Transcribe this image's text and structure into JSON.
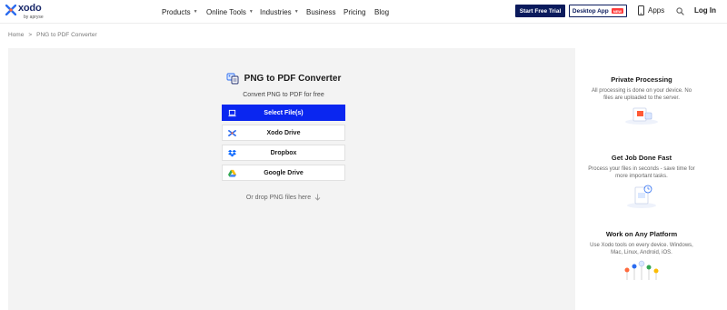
{
  "nav": {
    "logo_text": "xodo",
    "logo_sub": "by apryse",
    "menu": [
      {
        "label": "Products",
        "dropdown": true
      },
      {
        "label": "Online Tools",
        "dropdown": true
      },
      {
        "label": "Industries",
        "dropdown": true
      },
      {
        "label": "Business",
        "dropdown": false
      },
      {
        "label": "Pricing",
        "dropdown": false
      },
      {
        "label": "Blog",
        "dropdown": false
      }
    ],
    "start_trial": "Start Free Trial",
    "desktop_app": "Desktop App",
    "new_badge": "NEW",
    "apps": "Apps",
    "login": "Log In"
  },
  "breadcrumb": {
    "home": "Home",
    "separator": ">",
    "current": "PNG to PDF Converter"
  },
  "tool": {
    "title": "PNG to PDF Converter",
    "subtitle": "Convert PNG to PDF for free",
    "sources": [
      {
        "label": "Select File(s)",
        "icon": "laptop-icon",
        "primary": true
      },
      {
        "label": "Xodo Drive",
        "icon": "xodo-drive-icon",
        "primary": false
      },
      {
        "label": "Dropbox",
        "icon": "dropbox-icon",
        "primary": false
      },
      {
        "label": "Google Drive",
        "icon": "google-drive-icon",
        "primary": false
      }
    ],
    "drop_text": "Or drop PNG files here"
  },
  "features": [
    {
      "title": "Private Processing",
      "text": "All processing is done on your device. No files are uploaded to the server."
    },
    {
      "title": "Get Job Done Fast",
      "text": "Process your files in seconds - save time for more important tasks."
    },
    {
      "title": "Work on Any Platform",
      "text": "Use Xodo tools on every device. Windows, Mac, Linux, Android, iOS."
    }
  ],
  "colors": {
    "brand_navy": "#0a1a5c",
    "primary_blue": "#0a26f0",
    "panel_bg": "#f3f3f3",
    "badge_red": "#ff3b3b"
  }
}
